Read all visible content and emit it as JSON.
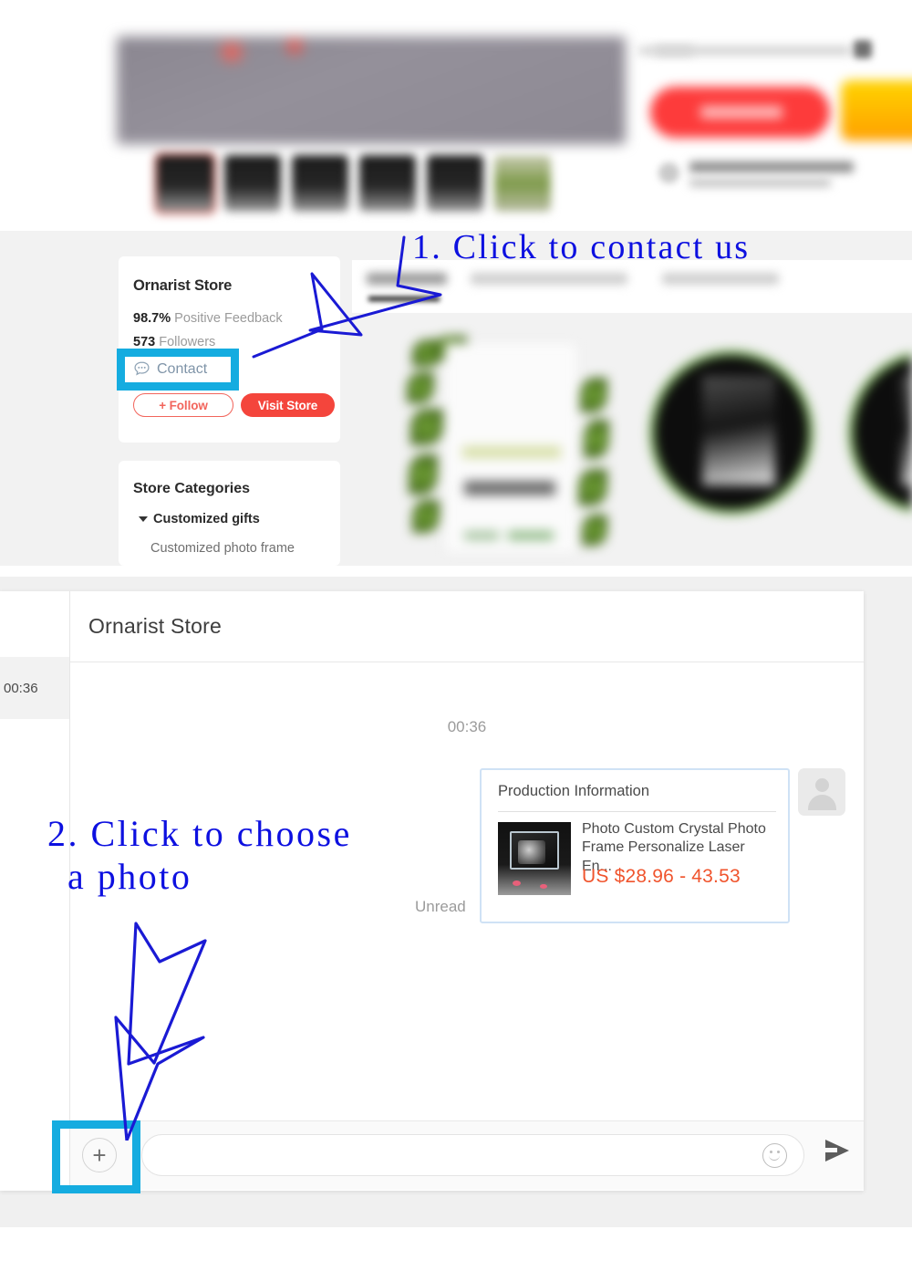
{
  "product_page": {
    "store_card": {
      "store_name": "Ornarist Store",
      "feedback_value": "98.7%",
      "feedback_label": "Positive Feedback",
      "followers_value": "573",
      "followers_label": "Followers",
      "contact_label": "Contact",
      "contact_icon": "chat-bubble-icon",
      "follow_button": "+ Follow",
      "visit_store_button": "Visit Store"
    },
    "categories_card": {
      "title": "Store Categories",
      "parent_category": "Customized gifts",
      "child_category": "Customized photo frame"
    }
  },
  "annotations": {
    "step1": "1. Click to contact us",
    "step2_line1": "2. Click to choose",
    "step2_line2": "a photo",
    "color": "#0d10e0",
    "highlight_color": "#15ace0"
  },
  "chat": {
    "header_title": "Ornarist Store",
    "sidebar_time": "00:36",
    "conversation_time": "00:36",
    "unread_label": "Unread",
    "avatar_icon": "user-avatar-icon",
    "product_message": {
      "card_title": "Production Information",
      "product_name": "Photo Custom Crystal Photo Frame Personalize Laser En...",
      "price": "US $28.96 - 43.53",
      "price_color": "#f0542d"
    },
    "footer": {
      "attach_icon": "plus-icon",
      "input_value": "",
      "input_placeholder": "",
      "emoji_icon": "smiley-icon",
      "send_icon": "send-arrow-icon"
    }
  }
}
